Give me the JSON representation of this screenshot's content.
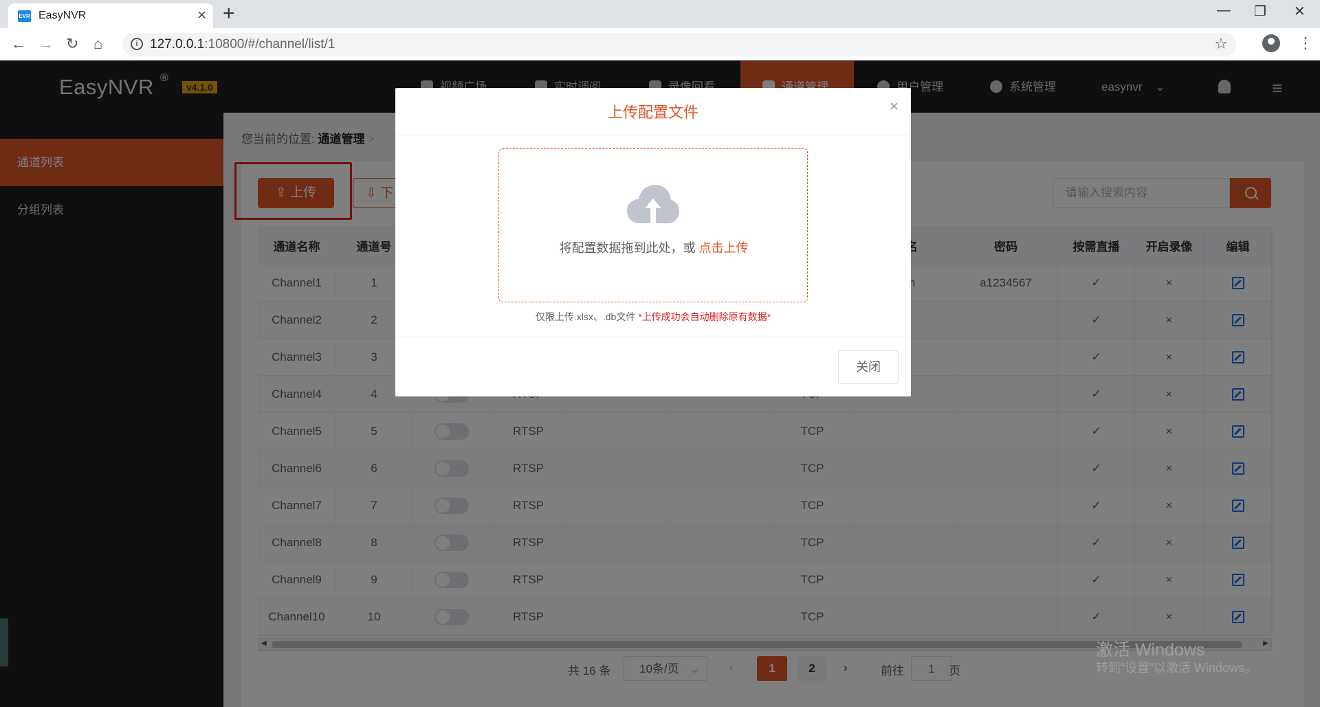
{
  "browser": {
    "tab_title": "EasyNVR",
    "favicon_text": "EVR",
    "url_host": "127.0.0.1",
    "url_rest": ":10800/#/channel/list/1"
  },
  "app": {
    "brand": "EasyNVR",
    "brand_mark": "®",
    "version": "v4.1.0",
    "nav": [
      {
        "label": "视频广场"
      },
      {
        "label": "实时调阅"
      },
      {
        "label": "录像回看"
      },
      {
        "label": "通道管理"
      },
      {
        "label": "用户管理"
      },
      {
        "label": "系统管理"
      }
    ],
    "user": "easynvr",
    "accent": "#e0572a"
  },
  "sidebar": {
    "items": [
      {
        "label": "通道列表"
      },
      {
        "label": "分组列表"
      }
    ]
  },
  "breadcrumb": {
    "prefix": "您当前的位置:",
    "current": "通道管理"
  },
  "toolbar": {
    "upload_label": "上传",
    "download_label": "下",
    "search_placeholder": "请输入搜索内容"
  },
  "table": {
    "headers": [
      "通道名称",
      "通道号",
      "名",
      "密码",
      "按需直播",
      "开启录像",
      "编辑"
    ],
    "rows": [
      {
        "name": "Channel1",
        "no": "1",
        "proto": "",
        "transport": "",
        "user": "in",
        "password": "a1234567"
      },
      {
        "name": "Channel2",
        "no": "2",
        "proto": "",
        "transport": "",
        "user": "",
        "password": ""
      },
      {
        "name": "Channel3",
        "no": "3",
        "proto": "",
        "transport": "",
        "user": "",
        "password": ""
      },
      {
        "name": "Channel4",
        "no": "4",
        "proto": "RTSP",
        "transport": "TCP",
        "user": "",
        "password": ""
      },
      {
        "name": "Channel5",
        "no": "5",
        "proto": "RTSP",
        "transport": "TCP",
        "user": "",
        "password": ""
      },
      {
        "name": "Channel6",
        "no": "6",
        "proto": "RTSP",
        "transport": "TCP",
        "user": "",
        "password": ""
      },
      {
        "name": "Channel7",
        "no": "7",
        "proto": "RTSP",
        "transport": "TCP",
        "user": "",
        "password": ""
      },
      {
        "name": "Channel8",
        "no": "8",
        "proto": "RTSP",
        "transport": "TCP",
        "user": "",
        "password": ""
      },
      {
        "name": "Channel9",
        "no": "9",
        "proto": "RTSP",
        "transport": "TCP",
        "user": "",
        "password": ""
      },
      {
        "name": "Channel10",
        "no": "10",
        "proto": "RTSP",
        "transport": "TCP",
        "user": "",
        "password": ""
      }
    ],
    "check_mark": "✓",
    "cross_mark": "×"
  },
  "pager": {
    "total": "共 16 条",
    "page_size": "10条/页",
    "pages": [
      "1",
      "2"
    ],
    "goto_label": "前往",
    "goto_value": "1",
    "page_unit": "页"
  },
  "watermark": {
    "line1": "激活 Windows",
    "line2": "转到“设置”以激活 Windows。"
  },
  "modal": {
    "title": "上传配置文件",
    "drop_text": "将配置数据拖到此处，或",
    "drop_link": "点击上传",
    "tip": "仅限上传.xlsx、.db文件",
    "tip_warn": "*上传成功会自动删除原有数据*",
    "close_label": "关闭"
  }
}
